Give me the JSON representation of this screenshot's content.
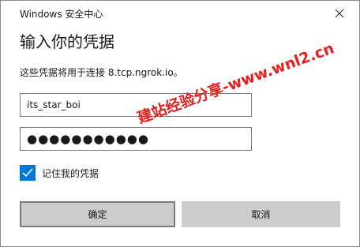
{
  "window": {
    "title": "Windows 安全中心",
    "close_icon": "close-icon"
  },
  "dialog": {
    "heading": "输入你的凭据",
    "message": "这些凭据将用于连接 8.tcp.ngrok.io。"
  },
  "fields": {
    "username_value": "its_star_boi",
    "password_mask": "●●●●●●●●●●●"
  },
  "remember": {
    "checked": true,
    "label": "记住我的凭据",
    "check_icon": "checkmark-icon"
  },
  "buttons": {
    "ok_label": "确定",
    "cancel_label": "取消"
  },
  "watermark": {
    "text": "建站经验分享-www.wnl2.cn",
    "color": "#e81e1e"
  },
  "colors": {
    "accent": "#0078d7",
    "button_bg": "#cccccc",
    "border": "#7a7a7a"
  }
}
